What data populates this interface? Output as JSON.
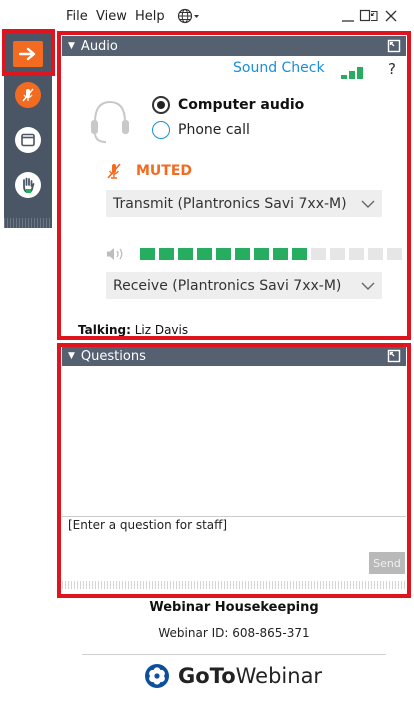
{
  "menu": {
    "file": "File",
    "view": "View",
    "help": "Help"
  },
  "audio": {
    "title": "Audio",
    "sound_check": "Sound Check",
    "help": "?",
    "options": {
      "computer": "Computer audio",
      "phone": "Phone call"
    },
    "selected_option": "computer",
    "muted_label": "MUTED",
    "transmit_device": "Transmit (Plantronics Savi 7xx-M)",
    "receive_device": "Receive (Plantronics Savi 7xx-M)",
    "input_level": {
      "lit": 9,
      "total": 14
    },
    "talking_label": "Talking:",
    "talking_name": "Liz Davis"
  },
  "questions": {
    "title": "Questions",
    "input_placeholder": "[Enter a question for staff]",
    "send_label": "Send"
  },
  "footer": {
    "title": "Webinar Housekeeping",
    "webinar_id": "Webinar ID: 608-865-371",
    "brand_bold": "GoTo",
    "brand_regular": "Webinar"
  },
  "colors": {
    "accent_orange": "#f26b21",
    "header_slate": "#556070",
    "link_blue": "#1a8fd6",
    "level_green": "#27ad5f",
    "highlight_red": "#e0141e"
  },
  "icons": {
    "toolbar": [
      "arrow-right-icon",
      "mic-muted-icon",
      "screen-icon",
      "raise-hand-icon"
    ],
    "menu": [
      "globe-icon",
      "minimize-icon",
      "maximize-icon",
      "close-icon"
    ]
  }
}
